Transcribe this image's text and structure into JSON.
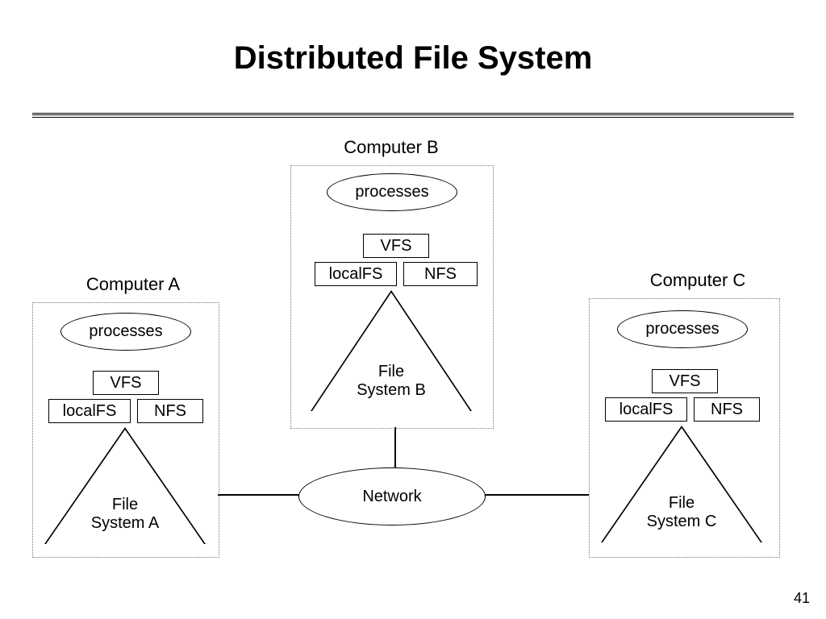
{
  "title": "Distributed File System",
  "page_number": "41",
  "network_label": "Network",
  "computers": [
    {
      "id": "A",
      "label": "Computer A",
      "processes_label": "processes",
      "vfs_label": "VFS",
      "localfs_label": "localFS",
      "nfs_label": "NFS",
      "fs_label": "File\nSystem A"
    },
    {
      "id": "B",
      "label": "Computer B",
      "processes_label": "processes",
      "vfs_label": "VFS",
      "localfs_label": "localFS",
      "nfs_label": "NFS",
      "fs_label": "File\nSystem B"
    },
    {
      "id": "C",
      "label": "Computer C",
      "processes_label": "processes",
      "vfs_label": "VFS",
      "localfs_label": "localFS",
      "nfs_label": "NFS",
      "fs_label": "File\nSystem C"
    }
  ]
}
